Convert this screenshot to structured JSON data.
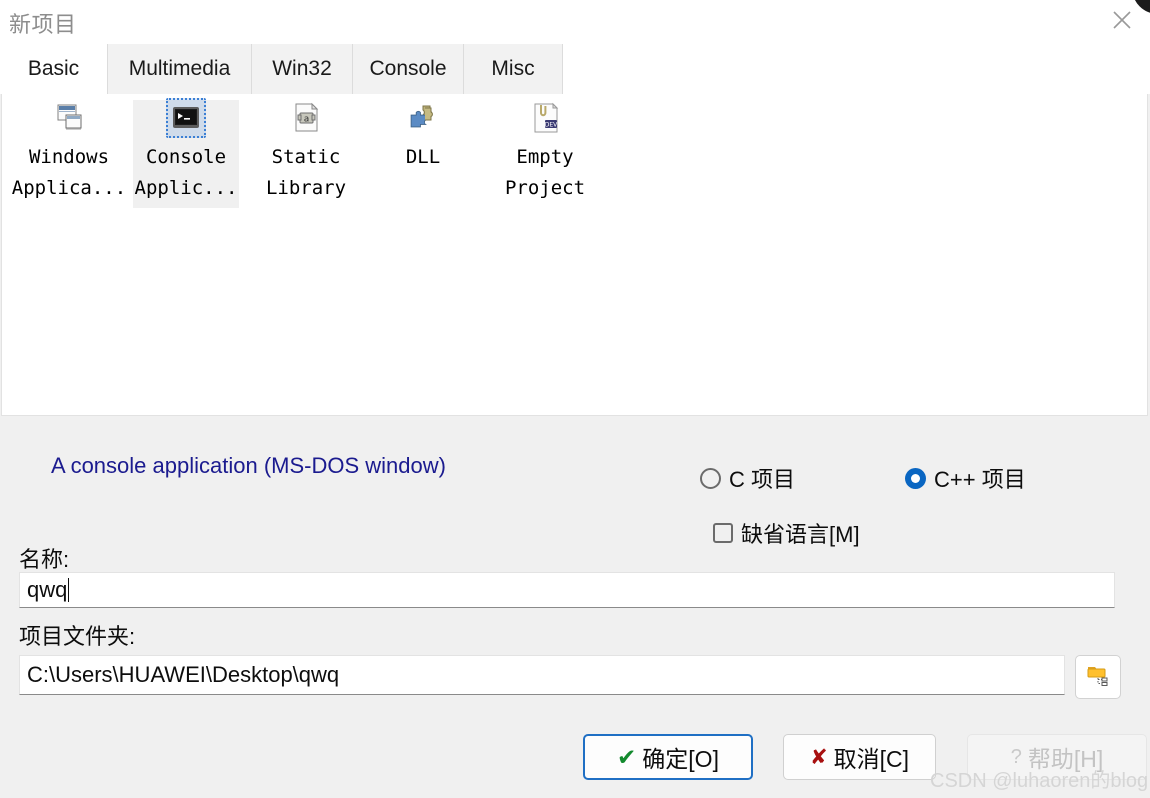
{
  "window": {
    "title": "新项目",
    "close_icon": "close-icon"
  },
  "tabs": [
    {
      "label": "Basic",
      "selected": true
    },
    {
      "label": "Multimedia",
      "selected": false
    },
    {
      "label": "Win32",
      "selected": false
    },
    {
      "label": "Console",
      "selected": false
    },
    {
      "label": "Misc",
      "selected": false
    }
  ],
  "project_types": [
    {
      "label": "Windows\nApplica...",
      "icon": "windows-application-icon",
      "selected": false
    },
    {
      "label": "Console\nApplic...",
      "icon": "console-application-icon",
      "selected": true
    },
    {
      "label": "Static\nLibrary",
      "icon": "static-library-icon",
      "selected": false
    },
    {
      "label": "DLL",
      "icon": "dll-icon",
      "selected": false
    },
    {
      "label": "Empty\nProject",
      "icon": "empty-project-icon",
      "selected": false
    }
  ],
  "description": "A console application (MS-DOS window)",
  "options": {
    "language_radios": [
      {
        "label": "C 项目",
        "checked": false
      },
      {
        "label": "C++ 项目",
        "checked": true
      }
    ],
    "default_language_checkbox": {
      "label": "缺省语言[M]",
      "checked": false
    }
  },
  "fields": {
    "name_label": "名称:",
    "name_value": "qwq",
    "folder_label": "项目文件夹:",
    "folder_value": "C:\\Users\\HUAWEI\\Desktop\\qwq",
    "browse_icon": "folder-browse-icon"
  },
  "buttons": {
    "ok": {
      "label": "确定[O]",
      "glyph": "check-icon"
    },
    "cancel": {
      "label": "取消[C]",
      "glyph": "cross-icon"
    },
    "help": {
      "label": "帮助[H]",
      "glyph": "question-icon",
      "disabled": true
    }
  },
  "watermark": "CSDN @luhaoren的blog",
  "colors": {
    "accent": "#0a66c2",
    "description_text": "#1b1b8f",
    "ok_check": "#138a2e",
    "cancel_cross": "#a81010",
    "dialog_bg": "#f0f0f0",
    "panel_bg": "#ffffff"
  }
}
